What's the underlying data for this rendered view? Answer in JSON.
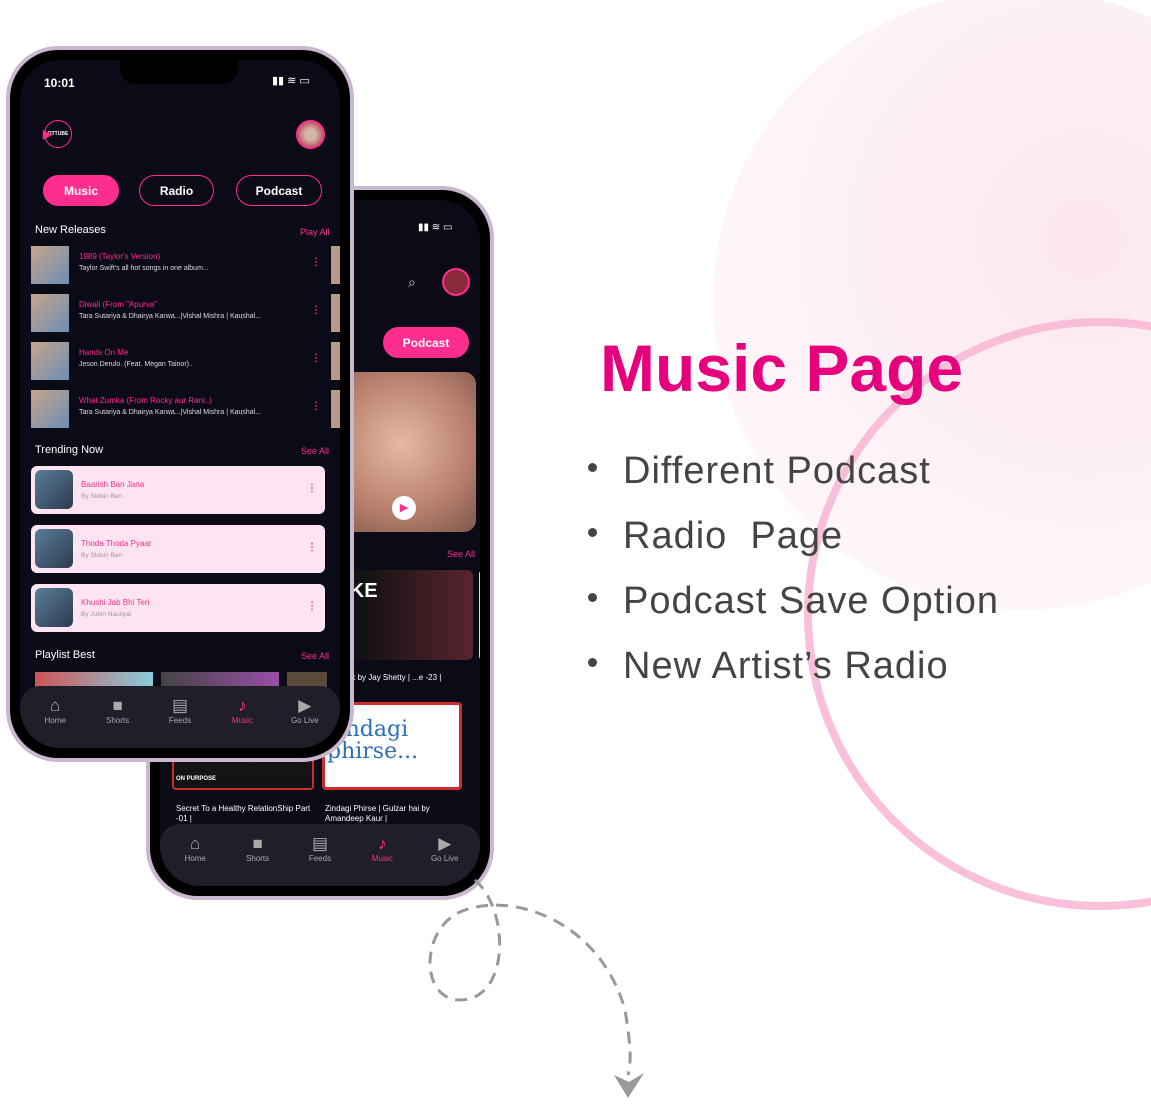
{
  "heading": "Music Page",
  "features": [
    "Different Podcast",
    "Radio  Page",
    "Podcast Save Option",
    "New Artist’s Radio"
  ],
  "colors": {
    "accent": "#ff2d8e",
    "background": "#0b0a17",
    "card": "#fde4f0"
  },
  "front_phone": {
    "time": "10:01",
    "logo": "OTTUBE",
    "tabs": [
      {
        "label": "Music",
        "active": true
      },
      {
        "label": "Radio"
      },
      {
        "label": "Podcast"
      }
    ],
    "new_releases": {
      "title": "New Releases",
      "action": "Play All",
      "items": [
        {
          "title": "1989 (Taylor's Version)",
          "subtitle": "Taylor Swift's all hot songs in one album..."
        },
        {
          "title": "Diwali (From \"Apurva\"",
          "subtitle": "Tara Sutariya & Dhairya Karwa...|Vishal Mishra | Kaushal..."
        },
        {
          "title": "Hands On Me",
          "subtitle": "Jeson Derulo. (Feat. Megan Tainor).."
        },
        {
          "title": "What Zumka (From Rocky aur Rani..)",
          "subtitle": "Tara Sutariya & Dhairya Karwa...|Vishal Mishra | Kaushal..."
        }
      ]
    },
    "trending": {
      "title": "Trending Now",
      "action": "See All",
      "items": [
        {
          "title": "Baarish Ban Jana",
          "subtitle": "By Stebin Ben"
        },
        {
          "title": "Thoda Thoda Pyaar",
          "subtitle": "By Stebin Ben"
        },
        {
          "title": "Khushi Jab Bhi Teri",
          "subtitle": "By Jubin Nautiyal"
        }
      ]
    },
    "playlist": {
      "title": "Playlist Best",
      "action": "See All"
    }
  },
  "back_phone": {
    "tab": "Podcast",
    "see_all": "See All",
    "videos": [
      {
        "caption": "...ike a Monk by Jay Shetty | ...e -23 | #Jayshetty",
        "thumb_text": "K LIKE NK"
      }
    ],
    "podcasts": [
      {
        "caption": "Secret To a Healthy RelationShip Part -01 |",
        "thumb_text": "ON PURPOSE"
      },
      {
        "caption": "Zindagi Phirse | Gulzar hai by Amandeep Kaur |",
        "thumb_text": "zindagi phirse..."
      }
    ]
  },
  "nav": [
    {
      "label": "Home",
      "icon": "home-icon"
    },
    {
      "label": "Shorts",
      "icon": "video-camera-icon"
    },
    {
      "label": "Feeds",
      "icon": "document-icon"
    },
    {
      "label": "Music",
      "icon": "music-note-icon",
      "active": true
    },
    {
      "label": "Go Live",
      "icon": "tv-icon"
    }
  ]
}
